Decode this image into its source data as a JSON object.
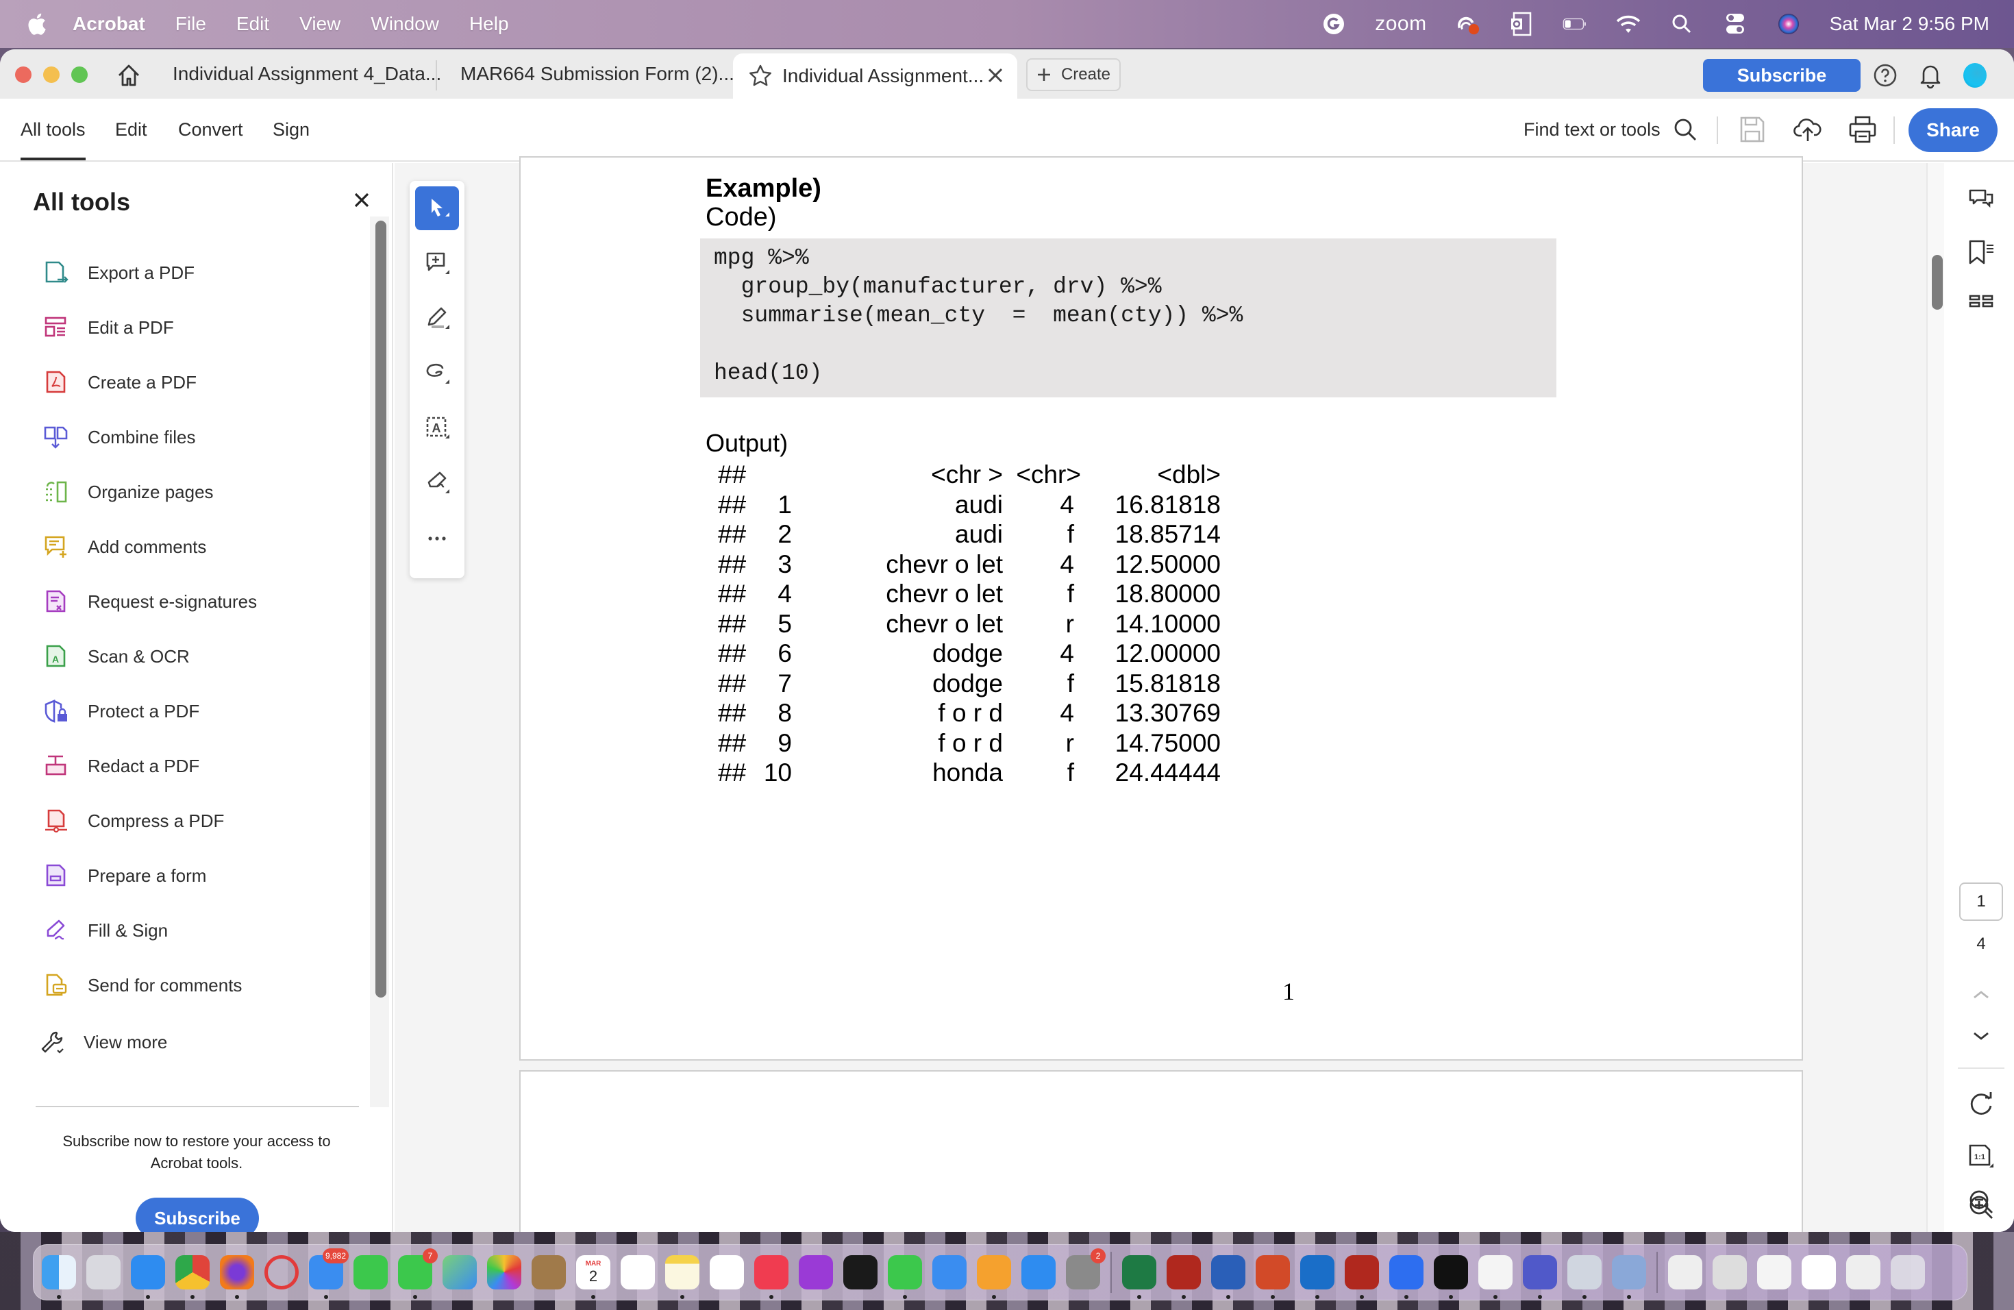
{
  "menubar": {
    "app_name": "Acrobat",
    "items": [
      "File",
      "Edit",
      "View",
      "Window",
      "Help"
    ],
    "status": {
      "zoom_label": "zoom",
      "datetime": "Sat Mar 2  9:56 PM"
    }
  },
  "tabs": {
    "items": [
      {
        "label": "Individual Assignment 4_Data..."
      },
      {
        "label": "MAR664 Submission Form (2)...."
      },
      {
        "label": "Individual Assignment..."
      }
    ],
    "create_label": "Create",
    "subscribe_label": "Subscribe"
  },
  "toolbar": {
    "nav": [
      "All tools",
      "Edit",
      "Convert",
      "Sign"
    ],
    "find_label": "Find text or tools",
    "share_label": "Share"
  },
  "left_panel": {
    "title": "All tools",
    "tools": [
      {
        "label": "Export a PDF",
        "icon": "export-pdf-icon",
        "color": "#2f8a8a"
      },
      {
        "label": "Edit a PDF",
        "icon": "edit-pdf-icon",
        "color": "#c0357a"
      },
      {
        "label": "Create a PDF",
        "icon": "create-pdf-icon",
        "color": "#d63b3b"
      },
      {
        "label": "Combine files",
        "icon": "combine-files-icon",
        "color": "#5a5ad6"
      },
      {
        "label": "Organize pages",
        "icon": "organize-pages-icon",
        "color": "#6db54a"
      },
      {
        "label": "Add comments",
        "icon": "add-comments-icon",
        "color": "#d4a520"
      },
      {
        "label": "Request e-signatures",
        "icon": "request-esignatures-icon",
        "color": "#a53cc0"
      },
      {
        "label": "Scan & OCR",
        "icon": "scan-ocr-icon",
        "color": "#3aa04a"
      },
      {
        "label": "Protect a PDF",
        "icon": "protect-pdf-icon",
        "color": "#5a5ad6"
      },
      {
        "label": "Redact a PDF",
        "icon": "redact-pdf-icon",
        "color": "#c0357a"
      },
      {
        "label": "Compress a PDF",
        "icon": "compress-pdf-icon",
        "color": "#d63b3b"
      },
      {
        "label": "Prepare a form",
        "icon": "prepare-form-icon",
        "color": "#8a4ad6"
      },
      {
        "label": "Fill & Sign",
        "icon": "fill-sign-icon",
        "color": "#8a4ad6"
      },
      {
        "label": "Send for comments",
        "icon": "send-for-comments-icon",
        "color": "#d4a520"
      }
    ],
    "view_more_label": "View more",
    "subscribe_note": "Subscribe now to restore your access to Acrobat tools.",
    "subscribe_label": "Subscribe"
  },
  "document": {
    "heading": "Example)",
    "code_label": "Code)",
    "code_lines": [
      "mpg %>%",
      "  group_by(manufacturer, drv) %>%",
      "  summarise(mean_cty  =  mean(cty)) %>%",
      "",
      "head(10)"
    ],
    "output_label": "Output)",
    "output_header": {
      "hash": "##",
      "manufacturer_type": "<chr >",
      "drv_type": "<chr>",
      "value_type": "<dbl>"
    },
    "output_rows": [
      {
        "idx": "1",
        "manufacturer": "audi",
        "drv": "4",
        "mean_cty": "16.81818"
      },
      {
        "idx": "2",
        "manufacturer": "audi",
        "drv": "f",
        "mean_cty": "18.85714"
      },
      {
        "idx": "3",
        "manufacturer": "chevr o let",
        "drv": "4",
        "mean_cty": "12.50000"
      },
      {
        "idx": "4",
        "manufacturer": "chevr o let",
        "drv": "f",
        "mean_cty": "18.80000"
      },
      {
        "idx": "5",
        "manufacturer": "chevr o let",
        "drv": "r",
        "mean_cty": "14.10000"
      },
      {
        "idx": "6",
        "manufacturer": "dodge",
        "drv": "4",
        "mean_cty": "12.00000"
      },
      {
        "idx": "7",
        "manufacturer": "dodge",
        "drv": "f",
        "mean_cty": "15.81818"
      },
      {
        "idx": "8",
        "manufacturer": "f o r d",
        "drv": "4",
        "mean_cty": "13.30769"
      },
      {
        "idx": "9",
        "manufacturer": "f o r d",
        "drv": "r",
        "mean_cty": "14.75000"
      },
      {
        "idx": "10",
        "manufacturer": "honda",
        "drv": "f",
        "mean_cty": "24.44444"
      }
    ],
    "page_number": "1"
  },
  "navigation": {
    "current_page": "1",
    "total_pages": "4"
  },
  "dock": {
    "mail_badge": "9,982",
    "messages_badge": "7",
    "settings_badge": "2",
    "calendar_month": "MAR",
    "calendar_day": "2"
  },
  "colors": {
    "accent": "#3a73d9"
  }
}
